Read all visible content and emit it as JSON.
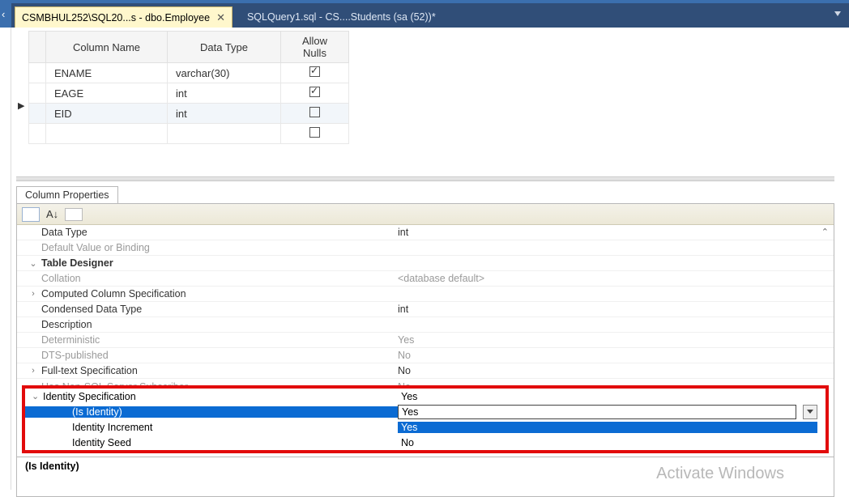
{
  "tabs": {
    "active": "CSMBHUL252\\SQL20...s - dbo.Employee",
    "inactive": "SQLQuery1.sql - CS....Students (sa (52))*"
  },
  "columns": {
    "headers": {
      "name": "Column Name",
      "type": "Data Type",
      "nulls": "Allow Nulls"
    },
    "rows": [
      {
        "name": "ENAME",
        "type": "varchar(30)",
        "null": true,
        "selected": false
      },
      {
        "name": "EAGE",
        "type": "int",
        "null": true,
        "selected": false
      },
      {
        "name": "EID",
        "type": "int",
        "null": false,
        "selected": true
      },
      {
        "name": "",
        "type": "",
        "null": false,
        "selected": false
      }
    ]
  },
  "cp_tab": "Column Properties",
  "props": [
    {
      "k": "Data Type",
      "v": "int"
    },
    {
      "k": "Default Value or Binding",
      "v": "",
      "muted": true
    },
    {
      "k": "Table Designer",
      "v": "",
      "section": true,
      "exp": "⌄"
    },
    {
      "k": "Collation",
      "v": "<database default>",
      "muted": true
    },
    {
      "k": "Computed Column Specification",
      "v": "",
      "exp": ">"
    },
    {
      "k": "Condensed Data Type",
      "v": "int"
    },
    {
      "k": "Description",
      "v": ""
    },
    {
      "k": "Deterministic",
      "v": "Yes",
      "muted": true
    },
    {
      "k": "DTS-published",
      "v": "No",
      "muted": true
    },
    {
      "k": "Full-text Specification",
      "v": "No",
      "exp": ">"
    },
    {
      "k": "Has Non-SQL Server Subscriber",
      "v": "No",
      "muted": true
    }
  ],
  "identity": {
    "head": {
      "k": "Identity Specification",
      "v": "Yes"
    },
    "is": {
      "k": "(Is Identity)",
      "v": "Yes"
    },
    "inc": {
      "k": "Identity Increment",
      "v": "Yes"
    },
    "seed": {
      "k": "Identity Seed",
      "v": "No"
    }
  },
  "desc_title": "(Is Identity)",
  "watermark": "Activate Windows"
}
